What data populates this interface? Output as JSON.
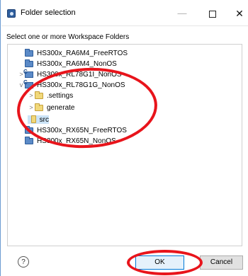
{
  "window": {
    "title": "Folder selection",
    "minimize": "—",
    "close": "✕"
  },
  "instruction": "Select one or more Workspace Folders",
  "tree": [
    {
      "label": "HS300x_RA6M4_FreeRTOS",
      "icon": "project-folder-icon",
      "twisty": "",
      "indent": 0,
      "selected": false
    },
    {
      "label": "HS300x_RA6M4_NonOS",
      "icon": "project-folder-icon",
      "twisty": "",
      "indent": 0,
      "selected": false
    },
    {
      "label": "HS300x_RL78G1I_NonOS",
      "icon": "c-project-icon",
      "twisty": ">",
      "indent": 0,
      "selected": false
    },
    {
      "label": "HS300x_RL78G1G_NonOS",
      "icon": "c-project-icon",
      "twisty": "v",
      "indent": 0,
      "selected": false
    },
    {
      "label": ".settings",
      "icon": "folder-icon",
      "twisty": ">",
      "indent": 1,
      "selected": false
    },
    {
      "label": "generate",
      "icon": "folder-icon",
      "twisty": ">",
      "indent": 1,
      "selected": false
    },
    {
      "label": "src",
      "icon": "folder-icon",
      "twisty": "",
      "indent": 1,
      "selected": true
    },
    {
      "label": "HS300x_RX65N_FreeRTOS",
      "icon": "project-folder-icon",
      "twisty": "",
      "indent": 0,
      "selected": false
    },
    {
      "label": "HS300x_RX65N_NonOS",
      "icon": "project-folder-icon",
      "twisty": "",
      "indent": 0,
      "selected": false
    }
  ],
  "buttons": {
    "help": "?",
    "ok": "OK",
    "cancel": "Cancel"
  },
  "colors": {
    "annotation_red": "#e8141b",
    "selection": "#cce4f7",
    "ok_border": "#0078d7"
  }
}
